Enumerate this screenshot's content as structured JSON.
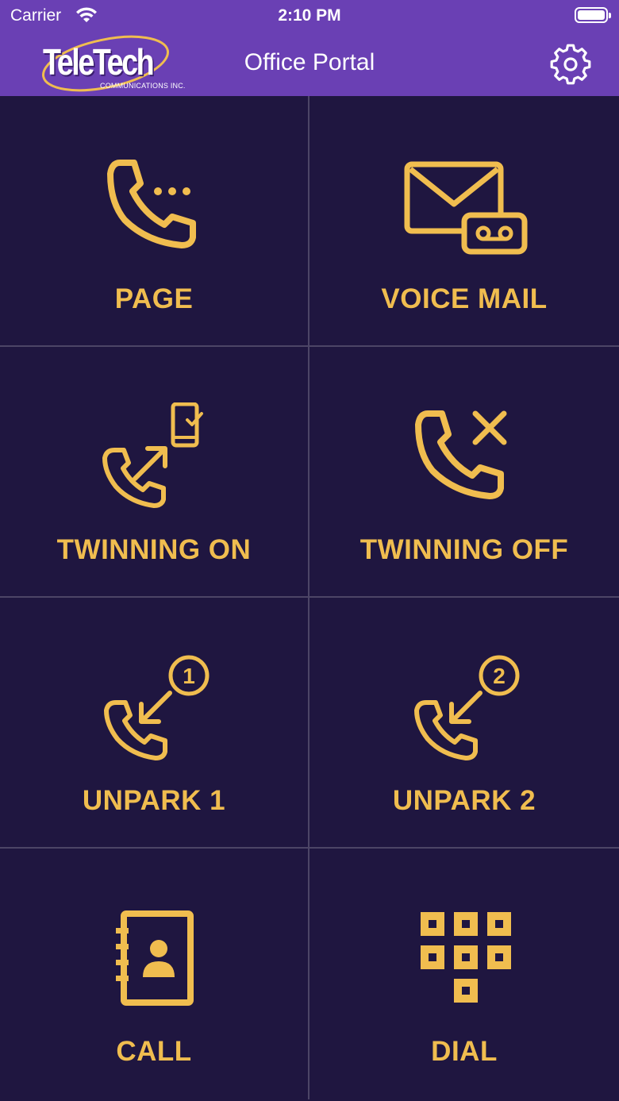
{
  "status_bar": {
    "carrier": "Carrier",
    "time": "2:10 PM"
  },
  "nav": {
    "logo_main": "TeleTech",
    "logo_sub": "COMMUNICATIONS INC.",
    "title": "Office Portal",
    "settings_icon": "gear-icon"
  },
  "colors": {
    "header_bg": "#6a40b4",
    "tile_bg": "#1f1640",
    "accent": "#f0bd4f",
    "divider": "#4c4566"
  },
  "tiles": [
    {
      "label": "PAGE",
      "icon": "phone-dots-icon"
    },
    {
      "label": "VOICE MAIL",
      "icon": "voicemail-icon"
    },
    {
      "label": "TWINNING ON",
      "icon": "phone-twinning-on-icon"
    },
    {
      "label": "TWINNING OFF",
      "icon": "phone-cancel-icon"
    },
    {
      "label": "UNPARK 1",
      "icon": "unpark-1-icon"
    },
    {
      "label": "UNPARK 2",
      "icon": "unpark-2-icon"
    },
    {
      "label": "CALL",
      "icon": "contacts-book-icon"
    },
    {
      "label": "DIAL",
      "icon": "dialpad-icon"
    }
  ]
}
